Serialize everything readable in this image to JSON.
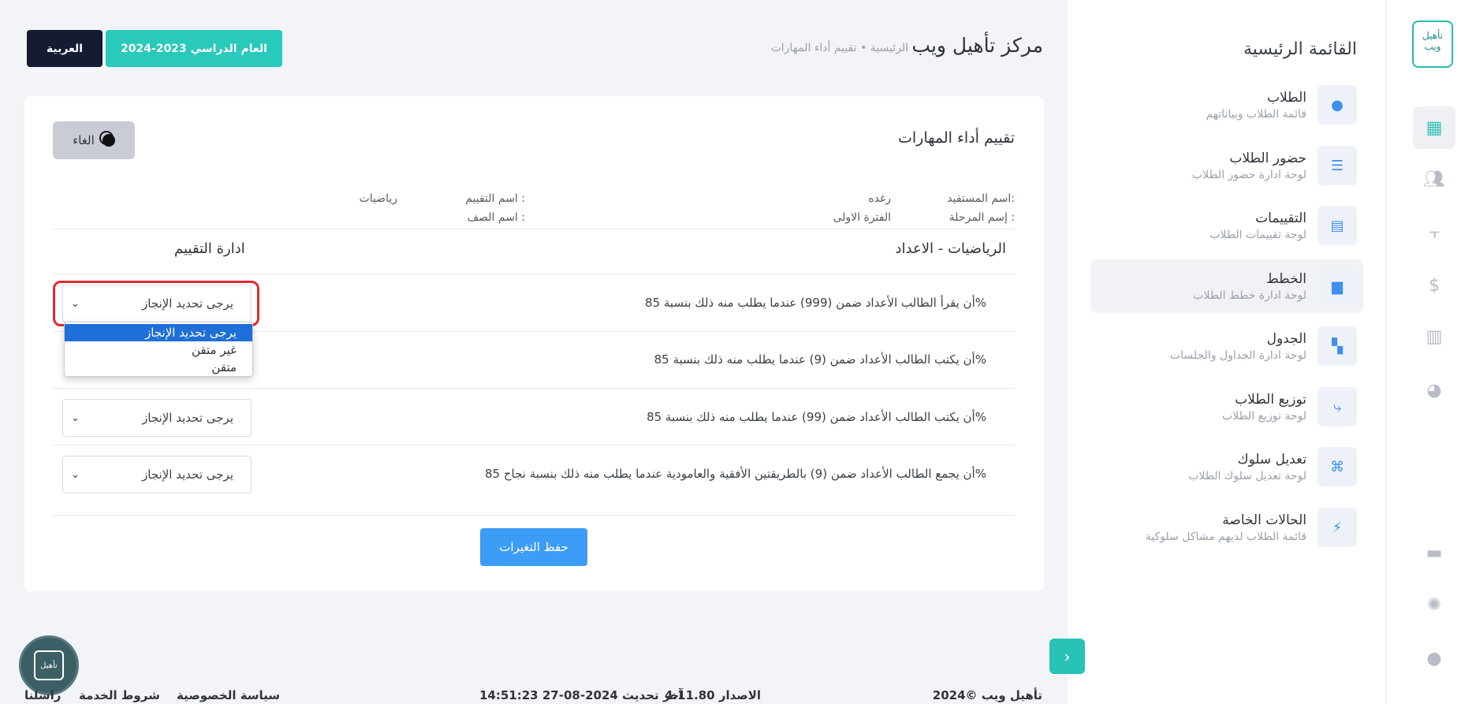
{
  "header": {
    "title": "مركز تأهيل ويب",
    "breadcrumb": "الرئيسية • تقييم أداء المهارات",
    "year_button": "العام الدراسي 2023-2024",
    "language_button": "العربية"
  },
  "rail": {
    "logo_text": "تأهيل ويب",
    "icons": [
      "dashboard-icon",
      "users-icon",
      "brush-icon",
      "dollar-icon",
      "building-icon",
      "pie-icon",
      "chat-icon",
      "gear-icon",
      "user-icon"
    ]
  },
  "sidebar": {
    "title": "القائمة الرئيسية",
    "items": [
      {
        "title": "الطلاب",
        "subtitle": "قائمة الطلاب وبياناتهم"
      },
      {
        "title": "حضور الطلاب",
        "subtitle": "لوحة ادارة حضور الطلاب"
      },
      {
        "title": "التقييمات",
        "subtitle": "لوحة تقييمات الطلاب"
      },
      {
        "title": "الخطط",
        "subtitle": "لوحة ادارة خطط الطلاب"
      },
      {
        "title": "الجدول",
        "subtitle": "لوحة ادارة الجداول والجلسات"
      },
      {
        "title": "توزيع الطلاب",
        "subtitle": "لوحة توزيع الطلاب"
      },
      {
        "title": "تعديل سلوك",
        "subtitle": "لوحة تعديل سلوك الطلاب"
      },
      {
        "title": "الحالات الخاصة",
        "subtitle": "قائمة الطلاب لديهم مشاكل سلوكية"
      }
    ]
  },
  "card": {
    "title": "تقييم أداء المهارات",
    "cancel_label": "الغاء",
    "beneficiary_label": "اسم المستفيد:",
    "beneficiary_value": "رغده",
    "stage_label": "إسم المرحلة :",
    "stage_value": "الفترة الاولى",
    "evaluation_label": "اسم التقييم :",
    "evaluation_value": "رياضيات",
    "class_label": "اسم الصف :",
    "section_title": "الرياضيات - الاعداد",
    "admin_title": "ادارة التقييم",
    "rows": [
      {
        "text": "أن يقرأ الطالب الأعداد ضمن (999) عندما يطلب منه ذلك بنسبة 85%",
        "value": "يرجى تحديد الإنجاز"
      },
      {
        "text": "أن يكتب الطالب الأعداد ضمن (9) عندما يطلب منه ذلك بنسبة 85%",
        "value": ""
      },
      {
        "text": "أن يكتب الطالب الأعداد ضمن (99) عندما يطلب منه ذلك بنسبة 85%",
        "value": "يرجى تحديد الإنجاز"
      },
      {
        "text": "أن يجمع الطالب الأعداد ضمن (9) بالطريقتين الأفقية والعامودية عندما يطلب منه ذلك بنسبة نجاح 85%",
        "value": "يرجى تحديد الإنجاز"
      }
    ],
    "dropdown_options": [
      "يرجى تحديد الإنجاز",
      "غير متقن",
      "متقن"
    ],
    "save_label": "حفظ التغيرات"
  },
  "footer": {
    "copyright": "2024© تأهيل ويب",
    "version": "الاصدار 4.11.80",
    "last_update": "آخر تحديث 2024-08-27 14:51:23",
    "privacy": "سياسة الخصوصية",
    "terms": "شروط الخدمة",
    "contact": "راسلنا"
  },
  "colors": {
    "accent": "#29c9bb",
    "dark": "#151b33",
    "primary": "#3c9cf6",
    "highlight": "#e02a2f"
  }
}
